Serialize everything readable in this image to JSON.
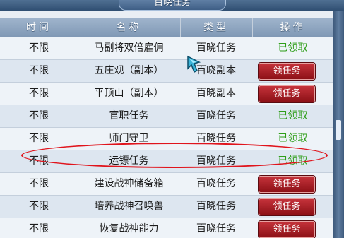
{
  "window": {
    "title": "百晓任务"
  },
  "columns": [
    "时间",
    "名称",
    "类型",
    "操作"
  ],
  "rows": [
    {
      "time": "不限",
      "name": "马副将双倍雇佣",
      "type": "百晓任务",
      "action": "已领取",
      "claimed": true
    },
    {
      "time": "不限",
      "name": "五庄观（副本）",
      "type": "百晓副本",
      "action": "领任务",
      "claimed": false
    },
    {
      "time": "不限",
      "name": "平顶山（副本）",
      "type": "百晓副本",
      "action": "领任务",
      "claimed": false
    },
    {
      "time": "不限",
      "name": "官职任务",
      "type": "百晓任务",
      "action": "已领取",
      "claimed": true
    },
    {
      "time": "不限",
      "name": "师门守卫",
      "type": "百晓任务",
      "action": "已领取",
      "claimed": true
    },
    {
      "time": "不限",
      "name": "运镖任务",
      "type": "百晓任务",
      "action": "已领取",
      "claimed": true
    },
    {
      "time": "不限",
      "name": "建设战神储备箱",
      "type": "百晓任务",
      "action": "领任务",
      "claimed": false
    },
    {
      "time": "不限",
      "name": "培养战神召唤兽",
      "type": "百晓任务",
      "action": "领任务",
      "claimed": false
    },
    {
      "time": "不限",
      "name": "恢复战神能力",
      "type": "百晓任务",
      "action": "领任务",
      "claimed": false
    }
  ],
  "colors": {
    "claimed": "#2f9e19",
    "button": "#a81f27",
    "annotation": "#e0141c"
  },
  "icons": {
    "cursor": "game-cursor-icon"
  }
}
